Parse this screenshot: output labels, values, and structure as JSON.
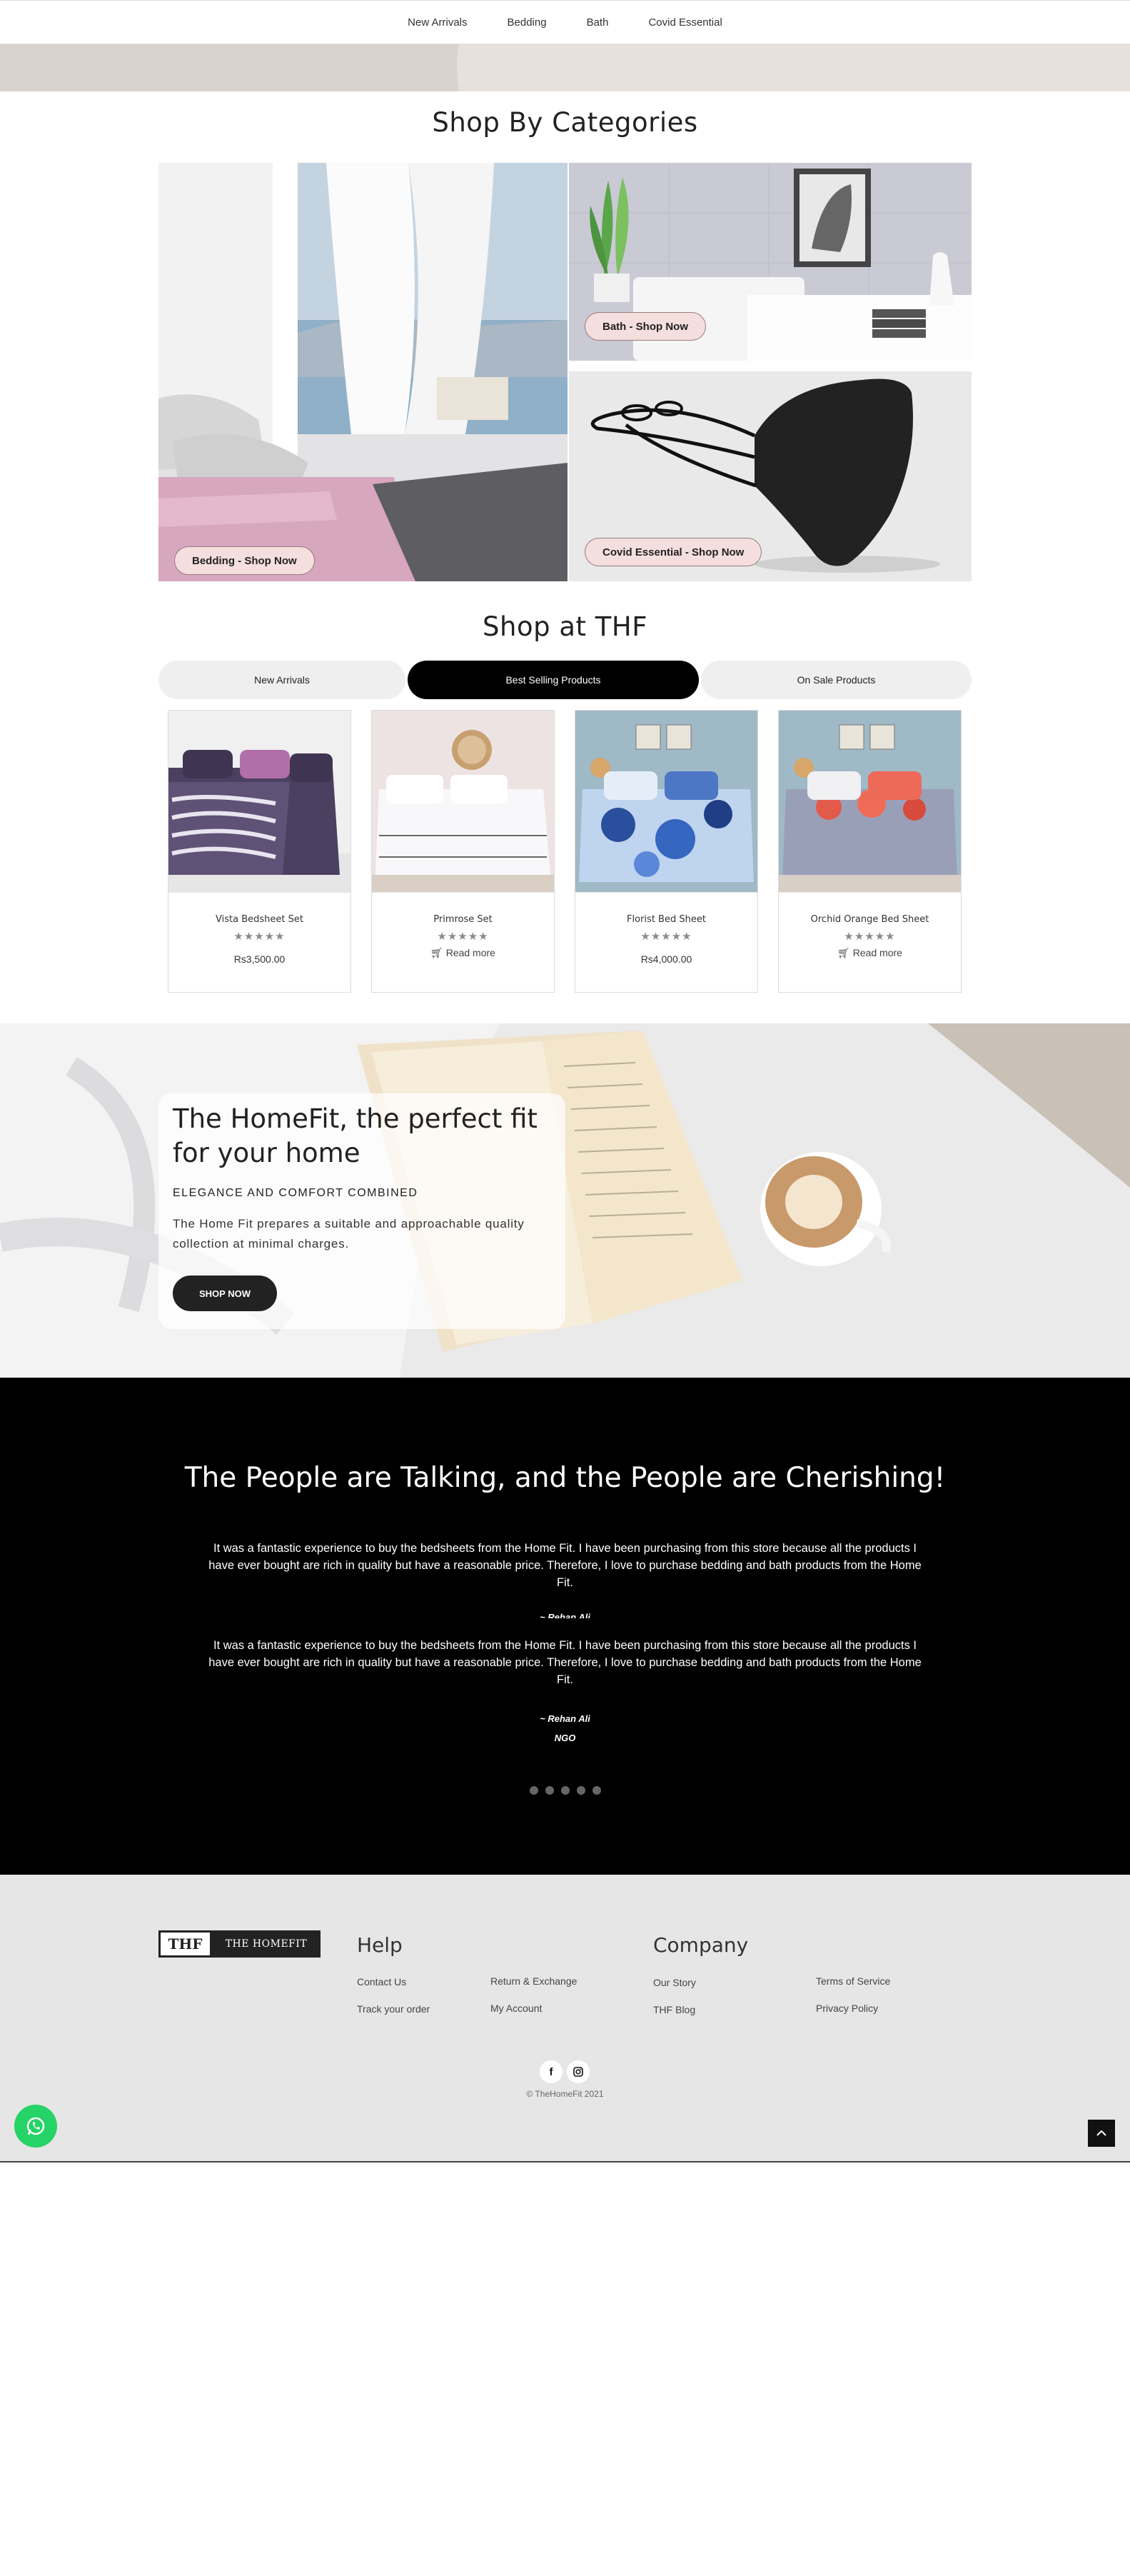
{
  "nav": {
    "items": [
      "New Arrivals",
      "Bedding",
      "Bath",
      "Covid Essential"
    ]
  },
  "categories": {
    "title": "Shop By Categories",
    "bedding_label": "Bedding - Shop Now",
    "bath_label": "Bath - Shop Now",
    "covid_label": "Covid Essential - Shop Now"
  },
  "shop": {
    "title": "Shop at THF",
    "tabs": [
      "New Arrivals",
      "Best Selling Products",
      "On Sale Products"
    ],
    "active_tab": "Best Selling Products",
    "products": [
      {
        "name": "Vista Bedsheet Set",
        "rating": 0,
        "price": "Rs3,500.00"
      },
      {
        "name": "Primrose Set",
        "rating": 0,
        "action": "Read more"
      },
      {
        "name": "Florist Bed Sheet",
        "rating": 0,
        "price": "Rs4,000.00"
      },
      {
        "name": "Orchid Orange Bed Sheet",
        "rating": 0,
        "action": "Read more"
      }
    ],
    "star_glyphs": "★★★★★"
  },
  "banner": {
    "title": "The HomeFit, the perfect fit for your home",
    "subtitle": "ELEGANCE AND COMFORT COMBINED",
    "text": "The Home Fit prepares a suitable and approachable quality collection at minimal charges.",
    "button": "SHOP NOW"
  },
  "testimonials": {
    "title": "The People are Talking, and the People are Cherishing!",
    "items": [
      {
        "quote": "It was a fantastic experience to buy the bedsheets from the Home Fit. I have been purchasing from this store because all the products I have ever bought are rich in quality but have a reasonable price. Therefore, I love to purchase bedding and bath products from the Home Fit.",
        "author": "~ Rehan Ali"
      },
      {
        "quote": "It was a fantastic experience to buy the bedsheets from the Home Fit. I have been purchasing from this store because all the products I have ever bought are rich in quality but have a reasonable price. Therefore, I love to purchase bedding and bath products from the Home Fit.",
        "author": "~ Rehan Ali",
        "org": "NGO"
      }
    ],
    "dot_count": 5
  },
  "footer": {
    "logo_mark": "THF",
    "logo_text": "THE HOMEFIT",
    "help_title": "Help",
    "help_links": [
      "Contact Us",
      "Track your order",
      "Return & Exchange",
      "My Account"
    ],
    "company_title": "Company",
    "company_links": [
      "Our Story",
      "THF Blog",
      "Terms of Service",
      "Privacy Policy"
    ],
    "copyright": "© TheHomeFit 2021"
  },
  "colors": {
    "accent": "#000000",
    "pill_bg": "#f5dede",
    "footer_bg": "#e6e6e6",
    "whatsapp": "#25d366"
  }
}
